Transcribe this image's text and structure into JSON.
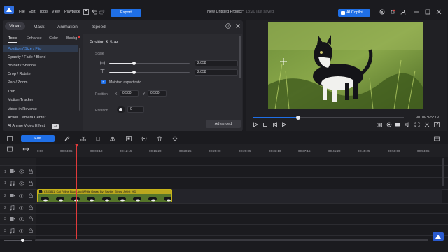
{
  "app": {
    "menu": [
      "File",
      "Edit",
      "Tools",
      "View",
      "Playback"
    ],
    "export_label": "Export",
    "project_title": "New Untitled Project*",
    "saved_text": "18:20 last saved",
    "copilot_label": "AI Copilot"
  },
  "panel": {
    "tabs": [
      "Video",
      "Mask",
      "Animation",
      "Speed"
    ],
    "subtabs": [
      "Tools",
      "Enhance",
      "Color",
      "Backg"
    ],
    "side_items": [
      "Position / Size / Flip",
      "Opacity / Fade / Blend",
      "Border / Shadow",
      "Crop / Rotate",
      "Pan / Zoom",
      "Trim",
      "Motion Tracker",
      "Video in Reverse",
      "Action Camera Center",
      "AI Anime Video Effect"
    ],
    "side_badge": "AI",
    "section_title": "Position & Size",
    "scale_label": "Scale",
    "scale_w_value": "2.058",
    "scale_h_value": "2.058",
    "scale_level": 0.3,
    "maintain_label": "Maintain aspect ratio",
    "position_label": "Position",
    "x_label": "X",
    "y_label": "Y",
    "pos_x": "0.500",
    "pos_y": "0.500",
    "rotation_label": "Rotation",
    "rotation_value": "0",
    "advanced_label": "Advanced"
  },
  "preview": {
    "timecode": "00:00:05:18",
    "progress": 0.3
  },
  "timeline": {
    "edit_label": "Edit",
    "ruler": [
      "0:00",
      "00:04:05",
      "00:08:10",
      "00:12:15",
      "00:16:20",
      "00:20:25",
      "00:25:00",
      "00:29:05",
      "00:33:10",
      "00:37:15",
      "00:41:20",
      "00:45:25",
      "00:50:00",
      "00:54:05"
    ],
    "tracks": [
      "1",
      "1",
      "2",
      "2",
      "3",
      "3"
    ],
    "clip_name": "6337811_Cat Feline Black And White Grass_By_Seville_Steps_Artlist_HD"
  },
  "colors": {
    "accent": "#1f6fe6",
    "playhead": "#e03a3a",
    "clip": "#c8b41a"
  }
}
